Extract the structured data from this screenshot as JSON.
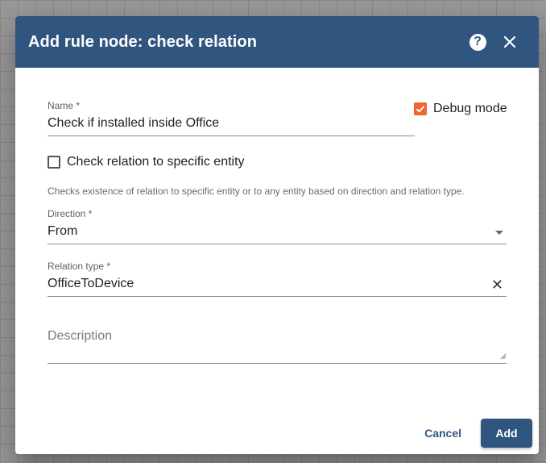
{
  "dialog": {
    "title": "Add rule node: check relation",
    "help_icon": "help-circle-icon",
    "close_icon": "close-icon"
  },
  "form": {
    "name": {
      "label": "Name *",
      "value": "Check if installed inside Office"
    },
    "debug_mode": {
      "label": "Debug mode",
      "checked": true
    },
    "check_specific": {
      "label": "Check relation to specific entity",
      "checked": false
    },
    "hint": "Checks existence of relation to specific entity or to any entity based on direction and relation type.",
    "direction": {
      "label": "Direction *",
      "value": "From"
    },
    "relation_type": {
      "label": "Relation type *",
      "value": "OfficeToDevice"
    },
    "description": {
      "placeholder": "Description"
    }
  },
  "actions": {
    "cancel": "Cancel",
    "add": "Add"
  },
  "colors": {
    "header": "#305680",
    "accent": "#f2652d"
  }
}
